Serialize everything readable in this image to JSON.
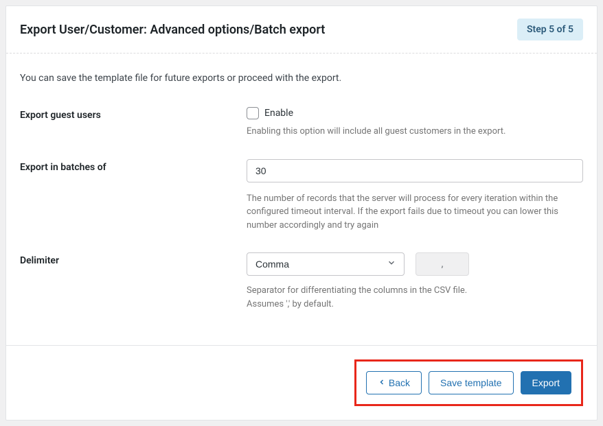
{
  "header": {
    "title": "Export User/Customer: Advanced options/Batch export",
    "step_badge": "Step 5 of 5"
  },
  "intro": "You can save the template file for future exports or proceed with the export.",
  "fields": {
    "guest_users": {
      "label": "Export guest users",
      "checkbox_label": "Enable",
      "help": "Enabling this option will include all guest customers in the export."
    },
    "batches": {
      "label": "Export in batches of",
      "value": "30",
      "help": "The number of records that the server will process for every iteration within the configured timeout interval. If the export fails due to timeout you can lower this number accordingly and try again"
    },
    "delimiter": {
      "label": "Delimiter",
      "value": "Comma",
      "preview": ",",
      "help": "Separator for differentiating the columns in the CSV file. Assumes ',' by default."
    }
  },
  "footer": {
    "back": "Back",
    "save": "Save template",
    "export": "Export"
  }
}
